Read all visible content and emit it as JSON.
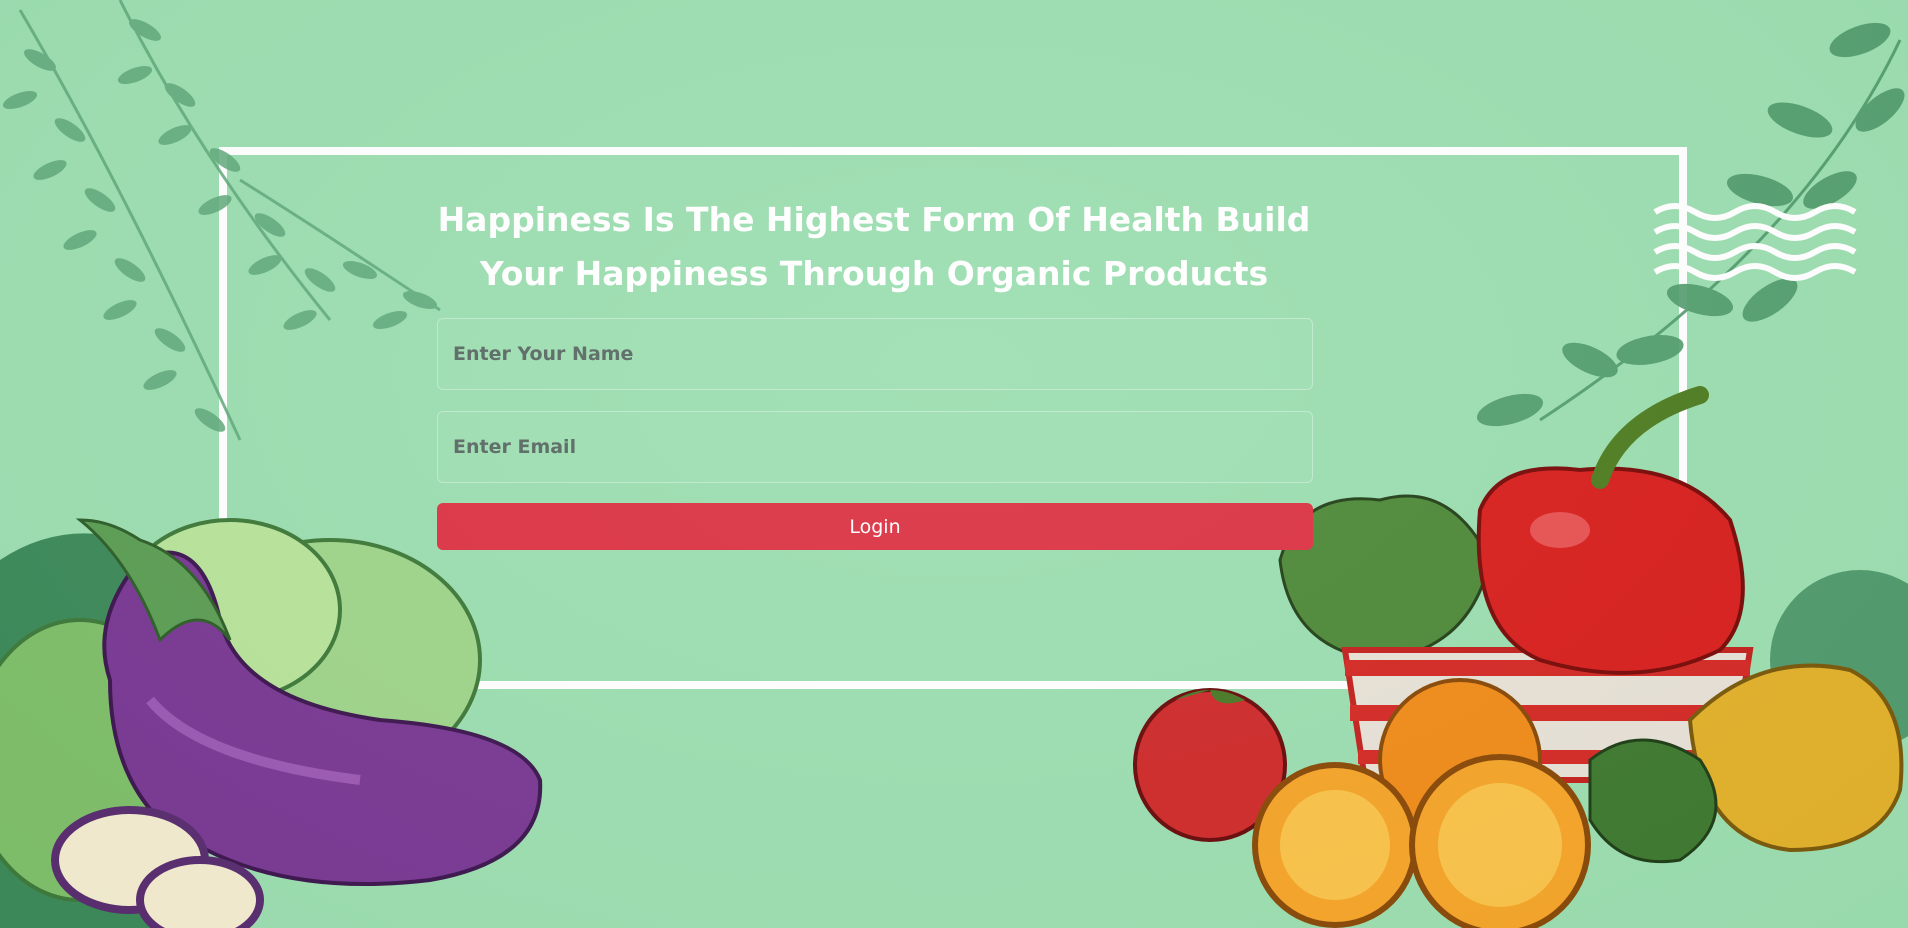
{
  "hero": {
    "heading_line1": "Happiness Is The Highest Form Of Health Build",
    "heading_line2": "Your Happiness Through Organic Products"
  },
  "form": {
    "name_placeholder": "Enter Your Name",
    "name_value": "",
    "email_placeholder": "Enter Email",
    "email_value": "",
    "login_label": "Login"
  },
  "colors": {
    "background": "#9cdeb0",
    "frame": "#ffffff",
    "login_button": "#dc3545",
    "heading": "#ffffff",
    "leaf": "#4f9a6b"
  },
  "icons": {
    "left_leaves": "vine-leaves-illustration",
    "right_leaves": "vine-leaves-illustration",
    "waves": "wave-lines-icon",
    "left_produce": "eggplant-lettuce-illustration",
    "right_produce": "pepper-tomato-orange-basket-illustration"
  }
}
